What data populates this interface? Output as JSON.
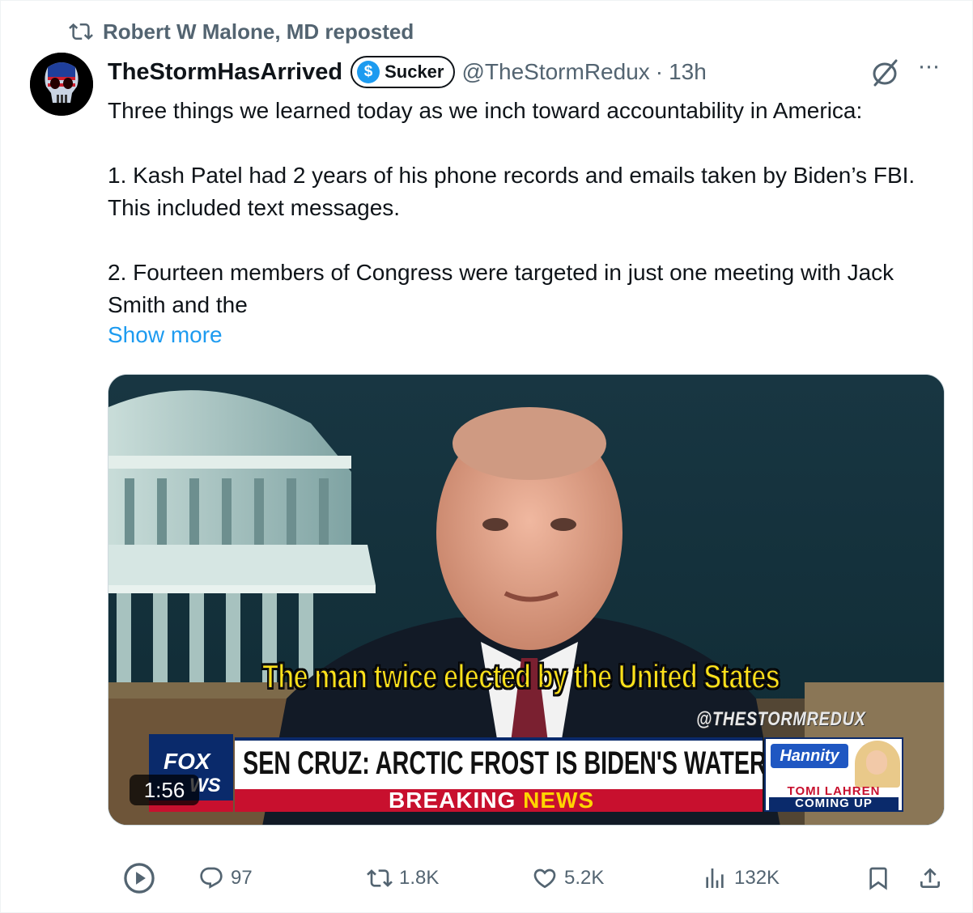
{
  "repost": {
    "label": "Robert W Malone, MD reposted",
    "icon": "repost-icon"
  },
  "author": {
    "avatar_icon": "skull-flag-avatar",
    "name": "TheStormHasArrived",
    "badge_symbol": "$",
    "badge_label": "Sucker",
    "handle": "@TheStormRedux",
    "separator": "·",
    "time": "13h"
  },
  "menu": {
    "more_label": "···",
    "grok_icon": "grok-icon"
  },
  "tweet": {
    "paragraphs": [
      "Three things we learned today as we inch toward accountability in America:",
      "1. Kash Patel had 2 years of his phone records and emails taken by Biden’s FBI. This included text messages.",
      "2. Fourteen members of Congress were targeted in just one meeting with Jack Smith and the"
    ],
    "show_more": "Show more"
  },
  "video": {
    "caption": "The man twice elected by the United States",
    "watermark": "@THESTORMREDUX",
    "logo_top": "FOX",
    "logo_bottom": "WS",
    "headline": "SEN CRUZ: ARCTIC FROST IS BIDEN'S WATERGATE",
    "breaking": "BREAKING",
    "news": "NEWS",
    "show_name": "Hannity",
    "guest": "TOMI LAHREN",
    "coming_up": "COMING UP",
    "duration": "1:56"
  },
  "actions": {
    "play_icon": "play-icon",
    "replies": "97",
    "reposts": "1.8K",
    "likes": "5.2K",
    "views": "132K",
    "bookmark_icon": "bookmark-icon",
    "share_icon": "share-icon"
  },
  "colors": {
    "link": "#1d9bf0",
    "muted": "#536471",
    "text": "#0f1419",
    "fox_blue": "#0a2a6b",
    "fox_red": "#c8102e",
    "caption_yellow": "#ffe21a"
  }
}
